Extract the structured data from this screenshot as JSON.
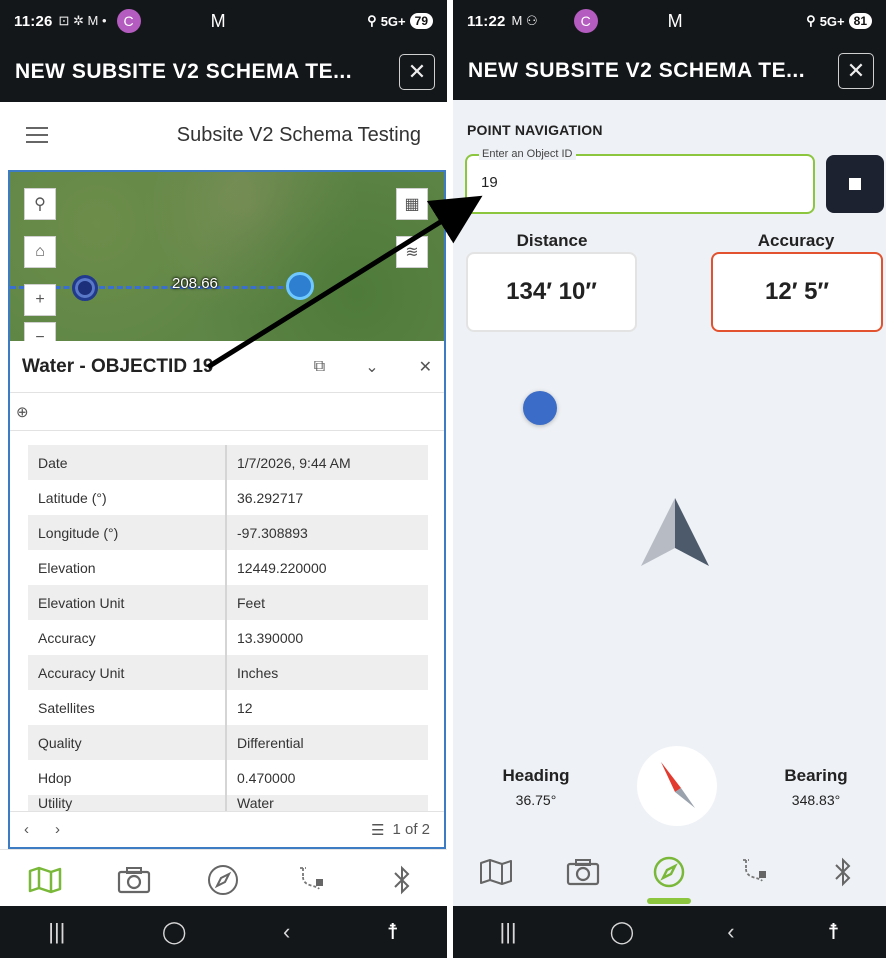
{
  "left": {
    "status": {
      "time": "11:26",
      "notif": "⊡ ✲ M •",
      "avatar": "C",
      "mail": "M",
      "signal": "5G+",
      "battery": "79"
    },
    "header": {
      "title": "NEW SUBSITE V2 SCHEMA TE...",
      "close_icon": "close-icon"
    },
    "app_title": "Subsite V2 Schema Testing",
    "map": {
      "distance_label": "208.66"
    },
    "popup": {
      "title": "Water - OBJECTID 19",
      "rows": [
        {
          "key": "Date",
          "value": "1/7/2026, 9:44 AM"
        },
        {
          "key": "Latitude (°)",
          "value": "36.292717"
        },
        {
          "key": "Longitude (°)",
          "value": "-97.308893"
        },
        {
          "key": "Elevation",
          "value": "12449.220000"
        },
        {
          "key": "Elevation Unit",
          "value": "Feet"
        },
        {
          "key": "Accuracy",
          "value": "13.390000"
        },
        {
          "key": "Accuracy Unit",
          "value": "Inches"
        },
        {
          "key": "Satellites",
          "value": "12"
        },
        {
          "key": "Quality",
          "value": "Differential"
        },
        {
          "key": "Hdop",
          "value": "0.470000"
        },
        {
          "key": "Utility",
          "value": "Water"
        }
      ],
      "pager": "1 of 2"
    },
    "nav_active": "map"
  },
  "right": {
    "status": {
      "time": "11:22",
      "notif": "M ⚇",
      "avatar": "C",
      "mail": "M",
      "signal": "5G+",
      "battery": "81"
    },
    "header": {
      "title": "NEW SUBSITE V2 SCHEMA TE..."
    },
    "section_label": "POINT NAVIGATION",
    "object_id": {
      "label": "Enter an Object ID",
      "value": "19"
    },
    "distance": {
      "label": "Distance",
      "value": "134′ 10″"
    },
    "accuracy": {
      "label": "Accuracy",
      "value": "12′ 5″"
    },
    "heading": {
      "label": "Heading",
      "value": "36.75°"
    },
    "bearing": {
      "label": "Bearing",
      "value": "348.83°"
    },
    "nav_active": "compass"
  },
  "colors": {
    "accent_green": "#8cc63f",
    "accuracy_border": "#e2522e",
    "header_bg": "#14171a",
    "point_blue": "#3b6cc7"
  }
}
